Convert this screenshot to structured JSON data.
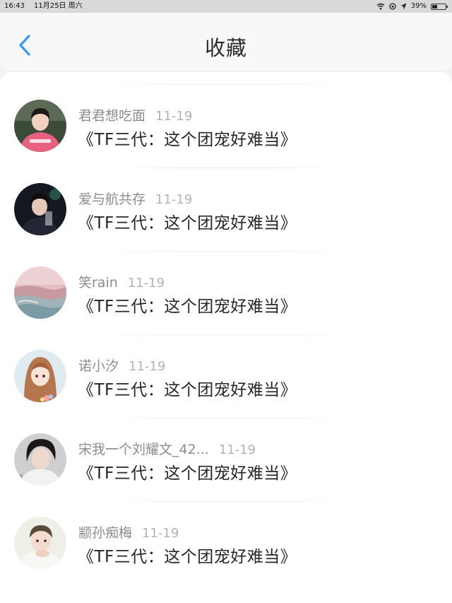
{
  "status_bar": {
    "time": "16:43",
    "date": "11月25日 周六",
    "battery": "39%",
    "battery_level": 0.39
  },
  "header": {
    "title": "收藏",
    "back_icon": "chevron-left-icon",
    "accent_color": "#3a9cf0"
  },
  "favorites": [
    {
      "user": "君君想吃面",
      "date": "11-19",
      "title": "《TF三代：这个团宠好难当》"
    },
    {
      "user": "爱与航共存",
      "date": "11-19",
      "title": "《TF三代：这个团宠好难当》"
    },
    {
      "user": "笑rain",
      "date": "11-19",
      "title": "《TF三代：这个团宠好难当》"
    },
    {
      "user": "诺小汐",
      "date": "11-19",
      "title": "《TF三代：这个团宠好难当》"
    },
    {
      "user": "宋我一个刘耀文_42...",
      "date": "11-19",
      "title": "《TF三代：这个团宠好难当》"
    },
    {
      "user": "颛孙痴梅",
      "date": "11-19",
      "title": "《TF三代：这个团宠好难当》"
    }
  ]
}
